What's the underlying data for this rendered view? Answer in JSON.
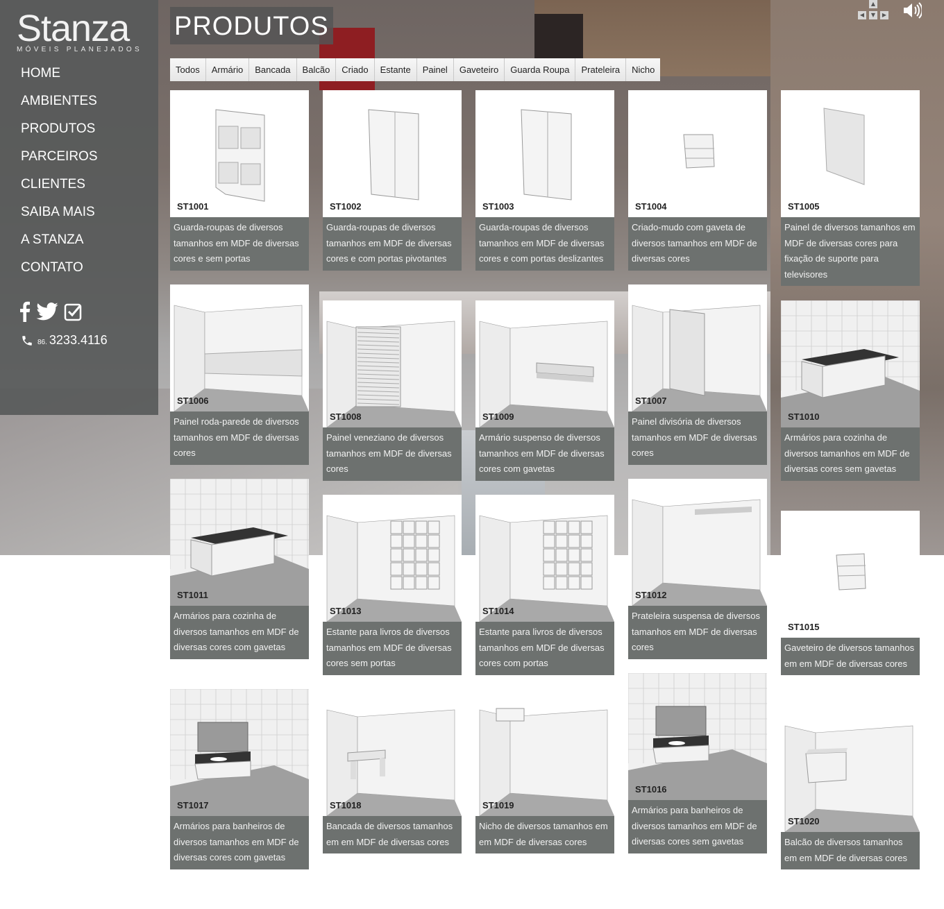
{
  "brand": {
    "name": "Stanza",
    "tagline": "MÓVEIS PLANEJADOS"
  },
  "nav": [
    "HOME",
    "AMBIENTES",
    "PRODUTOS",
    "PARCEIROS",
    "CLIENTES",
    "SAIBA MAIS",
    "A STANZA",
    "CONTATO"
  ],
  "contact": {
    "area_code": "86.",
    "phone": "3233.4116"
  },
  "page_title": "PRODUTOS",
  "filters": [
    "Todos",
    "Armário",
    "Bancada",
    "Balcão",
    "Criado",
    "Estante",
    "Painel",
    "Gaveteiro",
    "Guarda Roupa",
    "Prateleira",
    "Nicho"
  ],
  "products": [
    {
      "code": "ST1001",
      "type": "wardrobe-open",
      "description": "Guarda-roupas de diversos tamanhos em MDF de diversas cores e sem portas"
    },
    {
      "code": "ST1002",
      "type": "wardrobe-doors",
      "description": "Guarda-roupas de diversos tamanhos em MDF de diversas cores e com portas pivotantes"
    },
    {
      "code": "ST1003",
      "type": "wardrobe-doors",
      "description": "Guarda-roupas de diversos tamanhos em MDF de diversas cores e com portas deslizantes"
    },
    {
      "code": "ST1004",
      "type": "nightstand",
      "description": "Criado-mudo com gaveta de diversos tamanhos em MDF de diversas cores"
    },
    {
      "code": "ST1005",
      "type": "panel",
      "description": "Painel de diversos tamanhos em MDF de diversas cores para fixação de suporte para televisores"
    },
    {
      "code": "ST1006",
      "type": "room-baseboard",
      "description": "Painel roda-parede de diversos tamanhos em MDF de diversas cores"
    },
    {
      "code": "ST1008",
      "type": "room-louver",
      "description": "Painel veneziano de diversos tamanhos em MDF de diversas cores"
    },
    {
      "code": "ST1009",
      "type": "room-shelf-low",
      "description": "Armário suspenso de diversos tamanhos em MDF de diversas cores com gavetas"
    },
    {
      "code": "ST1007",
      "type": "room-divider",
      "description": "Painel divisória de diversos tamanhos em MDF de diversas cores"
    },
    {
      "code": "ST1010",
      "type": "tiled-kitchen",
      "description": "Armários para cozinha de diversos tamanhos em MDF de diversas cores sem gavetas"
    },
    {
      "code": "ST1011",
      "type": "tiled-kitchen",
      "description": "Armários para cozinha de diversos tamanhos em MDF de diversas cores com gavetas"
    },
    {
      "code": "ST1013",
      "type": "room-bookcase",
      "description": "Estante para livros de diversos tamanhos em MDF de diversas cores sem portas"
    },
    {
      "code": "ST1014",
      "type": "room-bookcase",
      "description": "Estante para livros de diversos tamanhos em MDF de diversas cores com portas"
    },
    {
      "code": "ST1012",
      "type": "room-shelf",
      "description": "Prateleira suspensa de diversos tamanhos em MDF de diversas cores"
    },
    {
      "code": "ST1015",
      "type": "drawer-unit",
      "description": "Gaveteiro de diversos tamanhos em em MDF de diversas cores"
    },
    {
      "code": "ST1017",
      "type": "tiled-bath",
      "description": "Armários para banheiros de diversos tamanhos em MDF de diversas cores com gavetas"
    },
    {
      "code": "ST1018",
      "type": "room-bench",
      "description": "Bancada de diversos tamanhos em em MDF de diversas cores"
    },
    {
      "code": "ST1019",
      "type": "room-niche",
      "description": "Nicho de diversos tamanhos em em MDF de diversas cores"
    },
    {
      "code": "ST1016",
      "type": "tiled-bath",
      "description": "Armários para banheiros de diversos tamanhos em MDF de diversas cores sem gavetas"
    },
    {
      "code": "ST1020",
      "type": "room-counter",
      "description": "Balcão de diversos tamanhos em em MDF de diversas cores"
    }
  ],
  "icons": {
    "facebook": "facebook-icon",
    "twitter": "twitter-icon",
    "foursquare": "check-icon",
    "phone": "phone-icon",
    "sound": "speaker-icon"
  },
  "colors": {
    "sidebar": "#585a5a",
    "caption_bg": "#6d716f",
    "title_bg": "#555555"
  }
}
